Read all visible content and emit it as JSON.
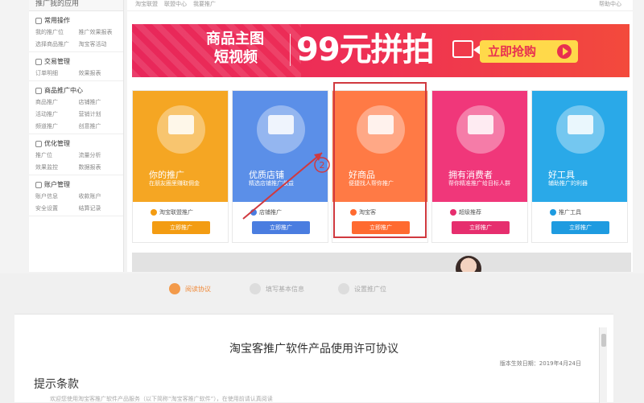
{
  "sidebar": {
    "header": "推广我的应用",
    "groups": [
      {
        "title": "常用操作",
        "icon": "shortcut-icon",
        "items": [
          "我的推广位",
          "推广效果报表",
          "选择商品推广",
          "淘宝客活动"
        ]
      },
      {
        "title": "交易管理",
        "icon": "trade-icon",
        "items": [
          "订单明细",
          "效果报表"
        ]
      },
      {
        "title": "商品推广中心",
        "icon": "goods-icon",
        "items": [
          "商品推广",
          "店铺推广",
          "活动推广",
          "营销计划",
          "频道推广",
          "创意推广"
        ]
      },
      {
        "title": "优化管理",
        "icon": "optimize-icon",
        "items": [
          "推广位",
          "流量分析",
          "效果监控",
          "数据报表"
        ]
      },
      {
        "title": "账户管理",
        "icon": "account-icon",
        "items": [
          "账户信息",
          "收款账户",
          "安全设置",
          "结算记录"
        ]
      }
    ]
  },
  "breadcrumb": [
    "淘宝联盟",
    "联盟中心",
    "我要推广"
  ],
  "help_link": "帮助中心",
  "banner": {
    "title_line1": "商品主图",
    "title_line2": "短视频",
    "price": "99元拼拍",
    "cta": "立即抢购",
    "video_icon": "video-camera-icon",
    "play_icon": "play-icon"
  },
  "cards": [
    {
      "headline": "你的推广",
      "sub": "在朋友圈里赚取佣金",
      "logo": "淘宝联盟推广",
      "button": "立即推广",
      "color": "#f5a623",
      "btn_color": "#f39c12",
      "logo_color": "#f39c12",
      "icon": "promote-illustration"
    },
    {
      "headline": "优质店铺",
      "sub": "精选店铺推广收益",
      "logo": "店铺推广",
      "button": "立即推广",
      "color": "#5b8fe8",
      "btn_color": "#4a7de0",
      "logo_color": "#4a7de0",
      "icon": "shop-illustration"
    },
    {
      "headline": "好商品",
      "sub": "便捷找人帮你推广",
      "logo": "淘宝客",
      "button": "立即推广",
      "color": "#ff7a45",
      "btn_color": "#ff6a30",
      "logo_color": "#ff6a30",
      "icon": "goods-illustration"
    },
    {
      "headline": "拥有消费者",
      "sub": "帮你精准推广给目标人群",
      "logo": "超级推荐",
      "button": "立即推广",
      "color": "#f0377a",
      "btn_color": "#e62e6e",
      "logo_color": "#e62e6e",
      "icon": "consumer-illustration"
    },
    {
      "headline": "好工具",
      "sub": "辅助推广的利器",
      "logo": "推广工具",
      "button": "立即推广",
      "color": "#2aa9e8",
      "btn_color": "#1e9be0",
      "logo_color": "#1e9be0",
      "icon": "tools-illustration"
    }
  ],
  "annotation": {
    "number": "2"
  },
  "steps": [
    {
      "label": "阅读协议",
      "active": true
    },
    {
      "label": "填写基本信息",
      "active": false
    },
    {
      "label": "设置推广位",
      "active": false
    }
  ],
  "agreement": {
    "title": "淘宝客推广软件产品使用许可协议",
    "date": "版本生效日期：2019年4月24日",
    "section": "提示条款",
    "body": "欢迎您使用淘宝客推广软件产品服务（以下简称“淘宝客推广软件”），在使用前请认真阅读"
  }
}
